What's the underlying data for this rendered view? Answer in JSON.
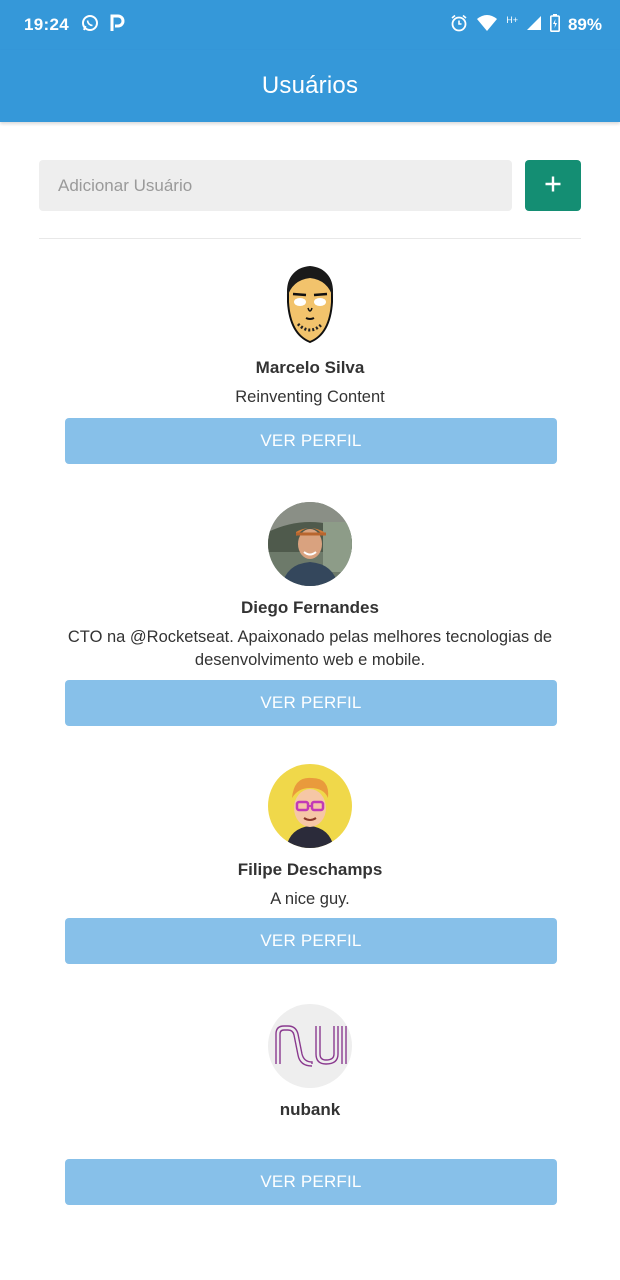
{
  "status_bar": {
    "time": "19:24",
    "battery": "89%",
    "left_icons": [
      "whatsapp-icon",
      "p-icon"
    ],
    "right_icons": [
      "alarm-icon",
      "wifi-icon",
      "network-type-icon",
      "signal-icon",
      "battery-icon"
    ],
    "network_type": "H+"
  },
  "app_bar": {
    "title": "Usuários"
  },
  "add_user": {
    "placeholder": "Adicionar Usuário",
    "value": "",
    "button_icon": "plus-icon"
  },
  "users": [
    {
      "name": "Marcelo Silva",
      "bio": "Reinventing Content",
      "button_label": "VER PERFIL",
      "avatar": "cartoon-face-avatar"
    },
    {
      "name": "Diego Fernandes",
      "bio": "CTO na @Rocketseat. Apaixonado pelas melhores tecnologias de desenvolvimento web e mobile.",
      "button_label": "VER PERFIL",
      "avatar": "photo-avatar"
    },
    {
      "name": "Filipe Deschamps",
      "bio": "A nice guy.",
      "button_label": "VER PERFIL",
      "avatar": "cartoon-glasses-avatar"
    },
    {
      "name": "nubank",
      "bio": "",
      "button_label": "VER PERFIL",
      "avatar": "nu-logo-avatar"
    }
  ],
  "colors": {
    "primary": "#3598d9",
    "add_button": "#148e73",
    "profile_button": "#87c0e9",
    "input_bg": "#eeeeee"
  }
}
